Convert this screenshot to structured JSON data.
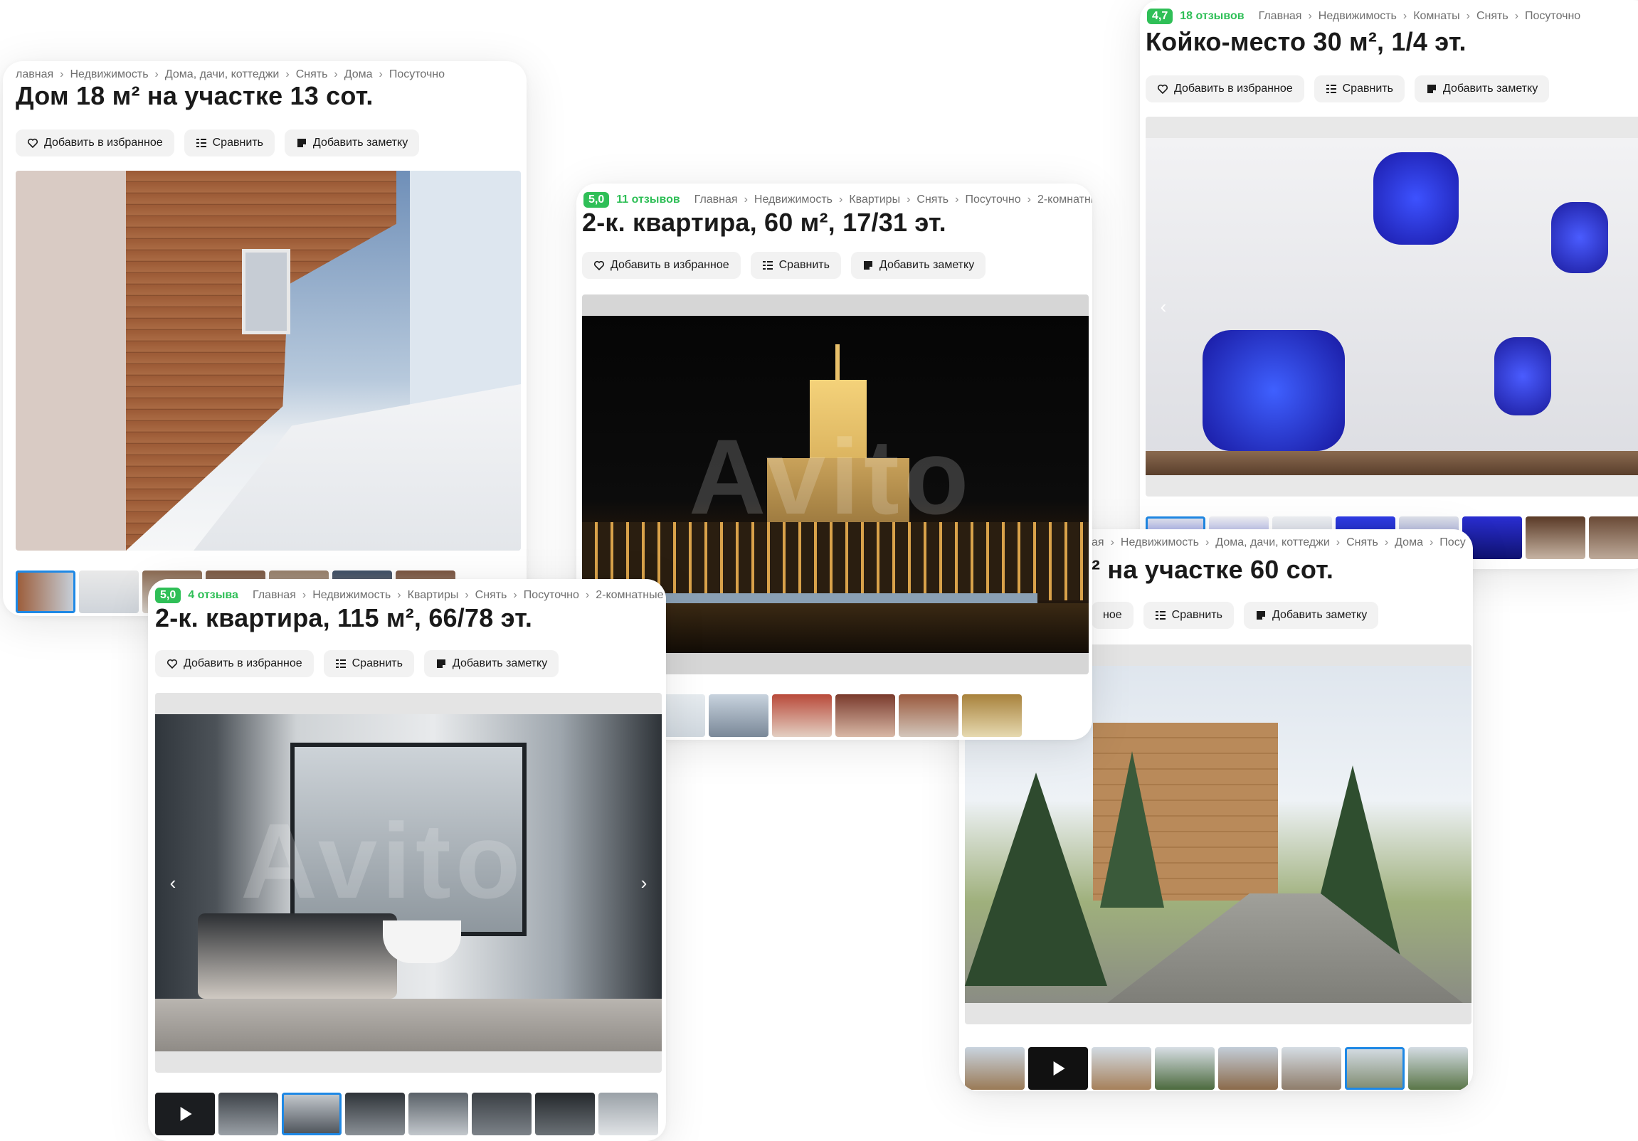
{
  "colors": {
    "rating_green": "#2fbf57",
    "active_thumb": "#1e88e5",
    "button_bg": "#f2f2f2"
  },
  "actions": {
    "favorite": "Добавить в избранное",
    "compare": "Сравнить",
    "note": "Добавить заметку"
  },
  "cards": {
    "house_small": {
      "breadcrumbs": [
        "лавная",
        "Недвижимость",
        "Дома, дачи, коттеджи",
        "Снять",
        "Дома",
        "Посуточно"
      ],
      "title": "Дом 18 м² на участке 13 сот."
    },
    "flat_60": {
      "rating": "5,0",
      "reviews": "11 отзывов",
      "breadcrumbs": [
        "Главная",
        "Недвижимость",
        "Квартиры",
        "Снять",
        "Посуточно",
        "2-комнатны"
      ],
      "title": "2-к. квартира, 60 м², 17/31 эт.",
      "watermark": "Avito"
    },
    "capsule": {
      "rating": "4,7",
      "reviews": "18 отзывов",
      "breadcrumbs": [
        "Главная",
        "Недвижимость",
        "Комнаты",
        "Снять",
        "Посуточно"
      ],
      "title": "Койко-место 30 м², 1/4 эт."
    },
    "flat_115": {
      "rating": "5,0",
      "reviews": "4 отзыва",
      "breadcrumbs": [
        "Главная",
        "Недвижимость",
        "Квартиры",
        "Снять",
        "Посуточно",
        "2-комнатные"
      ],
      "title": "2-к. квартира, 115 м², 66/78 эт.",
      "watermark": "Avito"
    },
    "castle": {
      "breadcrumbs": [
        "ая",
        "Недвижимость",
        "Дома, дачи, коттеджи",
        "Снять",
        "Дома",
        "Посу"
      ],
      "title": "² на участке 60 сот.",
      "favorite_partial": "ное"
    }
  }
}
